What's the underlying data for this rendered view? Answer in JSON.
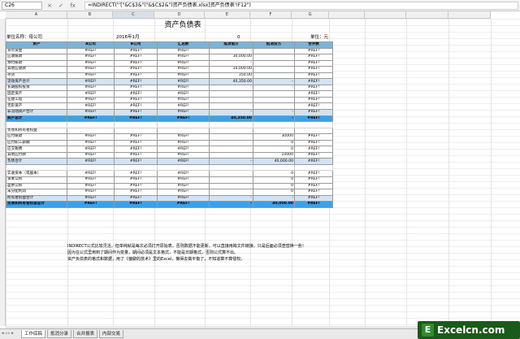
{
  "formula_bar": {
    "name_box": "C26",
    "cancel_icon": "×",
    "enter_icon": "✓",
    "fx_label": "fx",
    "formula": "=INDIRECT(\"'[\"&C$3&\"(\"&$C$2&\")资产负债表.xlsx]资产负债表'!F12\")"
  },
  "columns": [
    "A",
    "B",
    "C",
    "D",
    "E",
    "F",
    "G"
  ],
  "selected_column": "C",
  "report": {
    "title": "资产负债表",
    "unit_name": "单位名称：母公司",
    "period": "2016年1月",
    "zero": "0",
    "unit": "单位：元"
  },
  "table": {
    "headers": [
      "资产",
      "A公司",
      "B公司",
      "汇总数",
      "抵消借方",
      "抵消贷方",
      "合并数"
    ],
    "rows": [
      {
        "style": "plain",
        "cells": [
          "货币资金",
          "#REF!",
          "#REF!",
          "#REF!",
          "-",
          "",
          "#REF!"
        ]
      },
      {
        "style": "plain",
        "cells": [
          "应收账款",
          "#REF!",
          "#REF!",
          "#REF!",
          "30,000.00",
          "",
          "#REF!"
        ]
      },
      {
        "style": "plain",
        "cells": [
          "预付账款",
          "#REF!",
          "#REF!",
          "#REF!",
          "-",
          "",
          "#REF!"
        ]
      },
      {
        "style": "plain",
        "cells": [
          "其他应收款",
          "#REF!",
          "#REF!",
          "#REF!",
          "10,000.00",
          "",
          "#REF!"
        ]
      },
      {
        "style": "plain",
        "cells": [
          "存货",
          "#REF!",
          "#REF!",
          "#REF!",
          "350.00",
          "",
          "#REF!"
        ]
      },
      {
        "style": "sub",
        "cells": [
          "流动资产合计",
          "#REF!",
          "#REF!",
          "#REF!",
          "40,350.00",
          "-",
          "#REF!"
        ]
      },
      {
        "style": "plain",
        "cells": [
          "长期股权投资",
          "#REF!",
          "#REF!",
          "#REF!",
          "",
          "-",
          "#REF!"
        ]
      },
      {
        "style": "plain",
        "cells": [
          "固定资产",
          "#REF!",
          "#REF!",
          "#REF!",
          "",
          "",
          "#REF!"
        ]
      },
      {
        "style": "plain",
        "cells": [
          "在建工程",
          "#REF!",
          "#REF!",
          "#REF!",
          "",
          "",
          "#REF!"
        ]
      },
      {
        "style": "plain",
        "cells": [
          "无形资产",
          "#REF!",
          "#REF!",
          "#REF!",
          "",
          "",
          "#REF!"
        ]
      },
      {
        "style": "sub",
        "cells": [
          "非流动资产合计",
          "#REF!",
          "#REF!",
          "#REF!",
          "-",
          "-",
          "#REF!"
        ]
      },
      {
        "style": "sum",
        "cells": [
          "资产总计",
          "#REF!",
          "#REF!",
          "#REF!",
          "40,350.00",
          "-",
          "#REF!"
        ]
      },
      {
        "style": "blank",
        "cells": [
          "",
          "",
          "",
          "",
          "",
          "",
          ""
        ]
      },
      {
        "style": "plain",
        "cells": [
          "负债和所有者权益",
          "",
          "",
          "",
          "",
          "",
          ""
        ]
      },
      {
        "style": "plain",
        "cells": [
          "应付账款",
          "#REF!",
          "#REF!",
          "#REF!",
          "",
          "30000",
          "#REF!"
        ]
      },
      {
        "style": "plain",
        "cells": [
          "应付职工薪酬",
          "#REF!",
          "#REF!",
          "#REF!",
          "",
          "0",
          "#REF!"
        ]
      },
      {
        "style": "plain",
        "cells": [
          "应交税费",
          "#REF!",
          "#REF!",
          "#REF!",
          "",
          "0",
          "#REF!"
        ]
      },
      {
        "style": "plain",
        "cells": [
          "其他应付款",
          "#REF!",
          "#REF!",
          "#REF!",
          "",
          "10000",
          "#REF!"
        ]
      },
      {
        "style": "sub",
        "cells": [
          "负债合计",
          "#REF!",
          "#REF!",
          "#REF!",
          "-",
          "40,000.00",
          "#REF!"
        ]
      },
      {
        "style": "blank",
        "cells": [
          "",
          "",
          "",
          "",
          "",
          "",
          ""
        ]
      },
      {
        "style": "plain",
        "cells": [
          "实收资本（或股本）",
          "#REF!",
          "#REF!",
          "#REF!",
          "",
          "0",
          "#REF!"
        ]
      },
      {
        "style": "plain",
        "cells": [
          "资本公积",
          "#REF!",
          "#REF!",
          "#REF!",
          "",
          "0",
          "#REF!"
        ]
      },
      {
        "style": "plain",
        "cells": [
          "盈余公积",
          "#REF!",
          "#REF!",
          "#REF!",
          "",
          "0",
          "#REF!"
        ]
      },
      {
        "style": "plain",
        "cells": [
          "未分配利润",
          "#REF!",
          "#REF!",
          "#REF!",
          "",
          "0",
          "#REF!"
        ]
      },
      {
        "style": "sub",
        "cells": [
          "所有者权益合计",
          "#REF!",
          "#REF!",
          "#REF!",
          "-",
          "-",
          "#REF!"
        ]
      },
      {
        "style": "sum",
        "cells": [
          "负债和所有者权益总计",
          "#REF!",
          "#REF!",
          "#REF!",
          "-",
          "40,000.00",
          "#REF!"
        ]
      }
    ]
  },
  "notes": [
    "INDIRECT公式比较灵活，但单纯就是每次必须打开原始表，否则数据不能更新。可以直接用跨文件链接，只是后面必须查替换一些！",
    "因为在公式里用到了期间作为变量，期间必须是文本格式，不能是日期格式，否则公式算不出。",
    "资产负债表的格式和数据，用了《偏僻的技术》里的Excel，懒得去做平衡了，不知道算不算侵权。"
  ],
  "sheet_tabs": [
    "工作底稿",
    "抵消分录",
    "合并报表",
    "内部交易"
  ],
  "active_tab": "工作底稿",
  "logo_text": "Excelcn.com",
  "logo_icon": "E"
}
